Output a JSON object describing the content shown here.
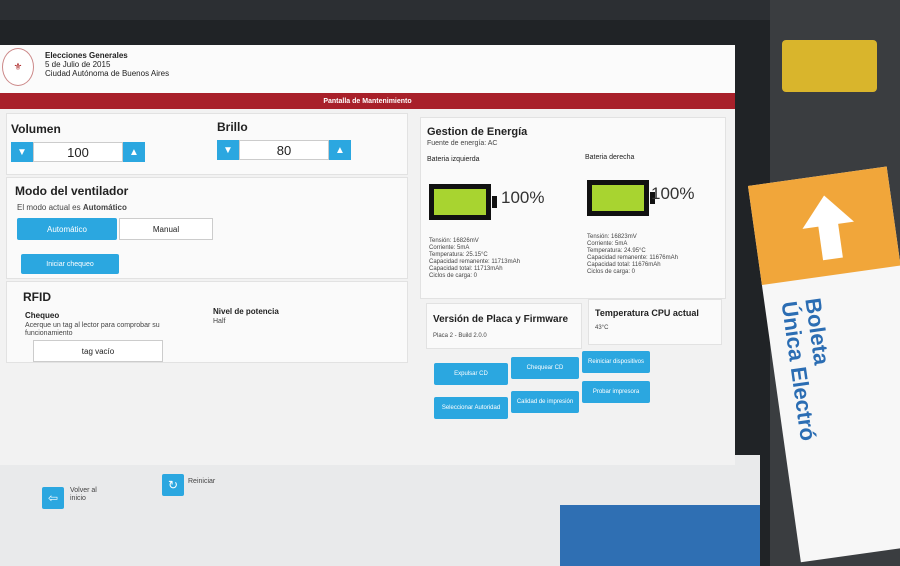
{
  "header": {
    "line1": "Elecciones Generales",
    "line2": "5 de Julio de 2015",
    "line3": "Ciudad Autónoma de Buenos Aires"
  },
  "titlebar": "Pantalla de Mantenimiento",
  "volume": {
    "label": "Volumen",
    "value": "100"
  },
  "brightness": {
    "label": "Brillo",
    "value": "80"
  },
  "fan": {
    "title": "Modo del ventilador",
    "current_prefix": "El modo actual es",
    "current_value": "Automático",
    "option_auto": "Automático",
    "option_manual": "Manual",
    "start_checks": "Iniciar chequeo"
  },
  "rfid": {
    "title": "RFID",
    "check_label": "Chequeo",
    "check_desc": "Acerque un tag al lector para comprobar su funcionamiento",
    "tag_status": "tag vacío",
    "power_label": "Nivel de potencia",
    "power_value": "Half"
  },
  "energy": {
    "title": "Gestion de Energía",
    "source": "Fuente de energía: AC",
    "left": {
      "name": "Bateria izquierda",
      "percent": "100%",
      "tension": "Tensión: 16826mV",
      "current": "Corriente: 5mA",
      "temp": "Temperatura: 25.15°C",
      "remaining": "Capacidad remanente: 11713mAh",
      "total": "Capacidad total: 11713mAh",
      "cycles": "Ciclos de carga: 0"
    },
    "right": {
      "name": "Bateria derecha",
      "percent": "100%",
      "tension": "Tensión: 16823mV",
      "current": "Corriente: 5mA",
      "temp": "Temperatura: 24.95°C",
      "remaining": "Capacidad remanente: 11676mAh",
      "total": "Capacidad total: 11676mAh",
      "cycles": "Ciclos de carga: 0"
    }
  },
  "firmware": {
    "title": "Versión de Placa y Firmware",
    "value": "Placa 2 - Build 2.0.0"
  },
  "cpu": {
    "title": "Temperatura CPU actual",
    "value": "43°C"
  },
  "actions": {
    "eject_cd": "Expulsar CD",
    "check_cd": "Chequear CD",
    "restart_devices": "Reiniciar dispositivos",
    "select_authority": "Seleccionar Autoridad",
    "print_quality": "Calidad de impresión",
    "test_printer": "Probar impresora"
  },
  "footer": {
    "back": "Volver al inicio",
    "restart": "Reiniciar"
  },
  "ballot": {
    "line1": "Boleta",
    "line2": "Única Electró"
  },
  "colors": {
    "accent": "#2ba7e0",
    "titlebar": "#a8202a",
    "battery": "#a8d430",
    "ballot_tab": "#f1a63a"
  }
}
